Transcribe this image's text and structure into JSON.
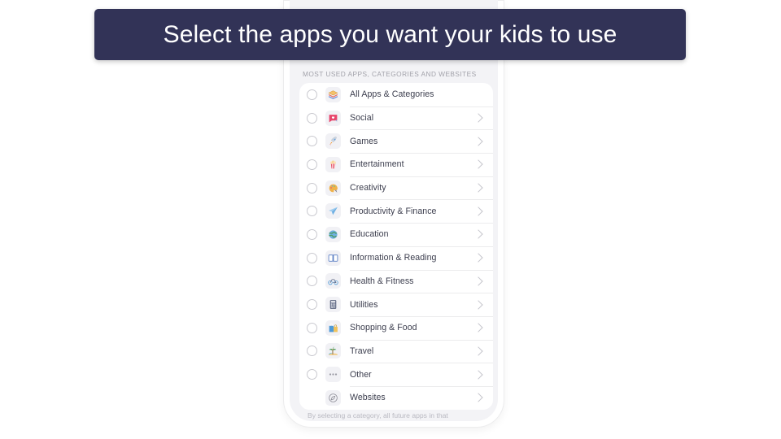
{
  "caption": {
    "text": "Select the apps you want your kids to use",
    "background_color": "#323357",
    "text_color": "#ffffff"
  },
  "phone": {
    "screen_background": "#f3f3f6",
    "card_background": "#ffffff"
  },
  "list": {
    "section_header": "MOST USED APPS, CATEGORIES AND WEBSITES",
    "footer_note": "By selecting a category, all future apps in that",
    "rows": [
      {
        "label": "All Apps & Categories",
        "icon": "stacked-layers-icon",
        "glyph": "🍔",
        "has_radio": true,
        "has_chevron": false
      },
      {
        "label": "Social",
        "icon": "heart-chat-bubble-icon",
        "glyph": "💝",
        "has_radio": true,
        "has_chevron": true
      },
      {
        "label": "Games",
        "icon": "rocket-icon",
        "glyph": "🚀",
        "has_radio": true,
        "has_chevron": true
      },
      {
        "label": "Entertainment",
        "icon": "popcorn-icon",
        "glyph": "🍿",
        "has_radio": true,
        "has_chevron": true
      },
      {
        "label": "Creativity",
        "icon": "palette-icon",
        "glyph": "🎨",
        "has_radio": true,
        "has_chevron": true
      },
      {
        "label": "Productivity & Finance",
        "icon": "paper-plane-icon",
        "glyph": "✈",
        "has_radio": true,
        "has_chevron": true
      },
      {
        "label": "Education",
        "icon": "globe-icon",
        "glyph": "🌍",
        "has_radio": true,
        "has_chevron": true
      },
      {
        "label": "Information & Reading",
        "icon": "open-book-icon",
        "glyph": "📖",
        "has_radio": true,
        "has_chevron": true
      },
      {
        "label": "Health & Fitness",
        "icon": "bicycle-icon",
        "glyph": "🚲",
        "has_radio": true,
        "has_chevron": true
      },
      {
        "label": "Utilities",
        "icon": "calculator-icon",
        "glyph": "🗓",
        "has_radio": true,
        "has_chevron": true
      },
      {
        "label": "Shopping & Food",
        "icon": "shopping-bags-icon",
        "glyph": "🛍",
        "has_radio": true,
        "has_chevron": true
      },
      {
        "label": "Travel",
        "icon": "island-palm-icon",
        "glyph": "🏝",
        "has_radio": true,
        "has_chevron": true
      },
      {
        "label": "Other",
        "icon": "ellipsis-icon",
        "glyph": "•••",
        "has_radio": true,
        "has_chevron": true
      },
      {
        "label": "Websites",
        "icon": "compass-icon",
        "glyph": "⊘",
        "has_radio": false,
        "has_chevron": true
      }
    ]
  }
}
